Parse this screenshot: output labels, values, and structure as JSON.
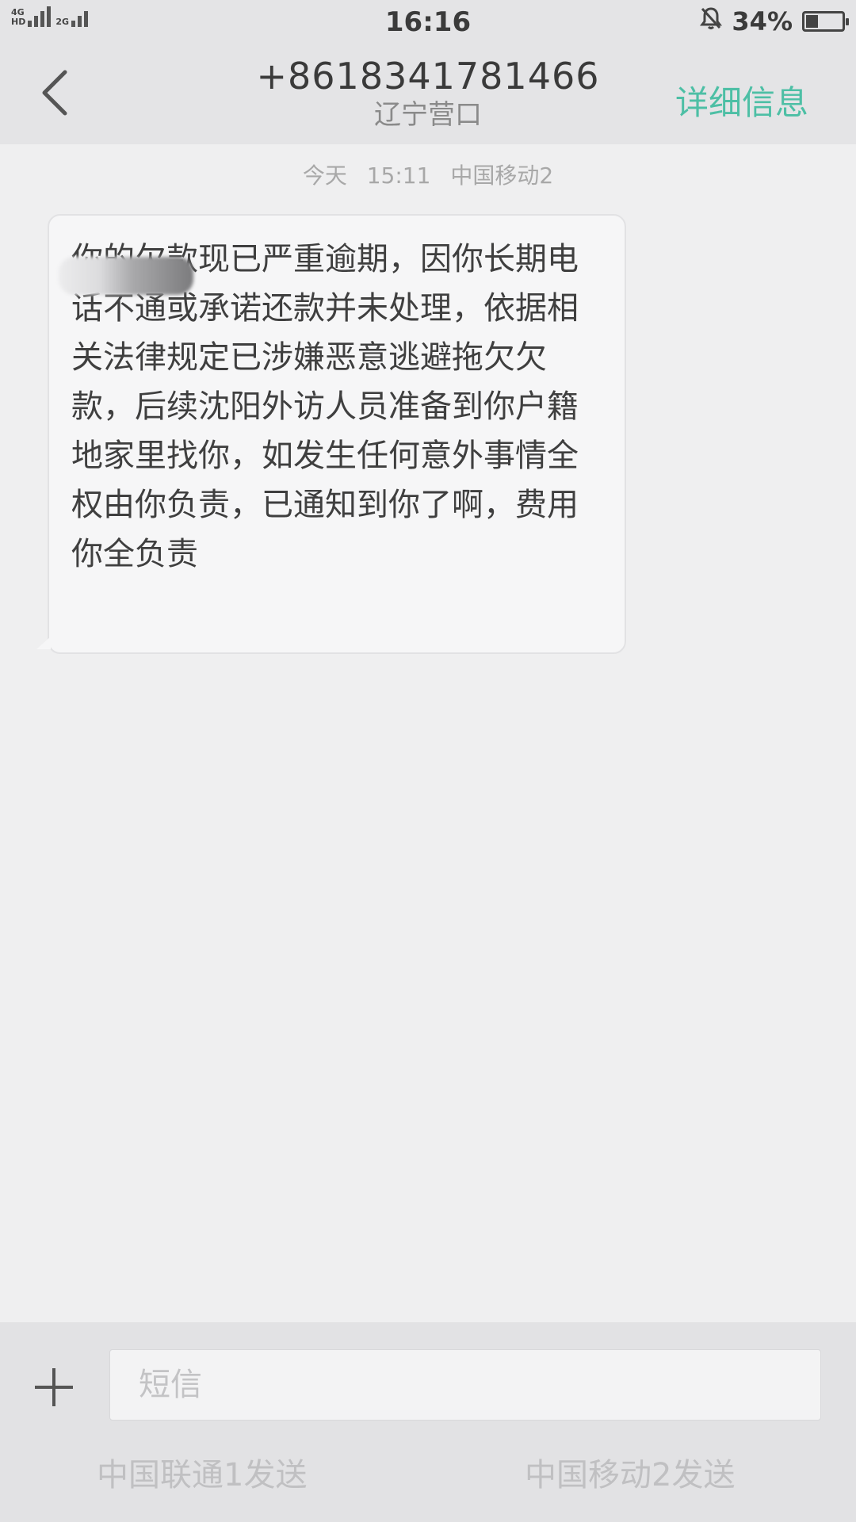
{
  "status_bar": {
    "network_1": "4G",
    "network_1_sub": "HD",
    "network_2": "2G",
    "time": "16:16",
    "battery_percent": "34%",
    "battery_level": 0.34
  },
  "header": {
    "phone_number": "+8618341781466",
    "location": "辽宁营口",
    "details_label": "详细信息",
    "details_color": "#4dbfa5"
  },
  "conversation": {
    "timestamp_day": "今天",
    "timestamp_time": "15:11",
    "timestamp_carrier": "中国移动2",
    "messages": [
      {
        "direction": "incoming",
        "text": "你的欠款现已严重逾期，因你长期电话不通或承诺还款并未处理，依据相关法律规定已涉嫌恶意逃避拖欠欠款，后续沈阳外访人员准备到你户籍地家里找你，如发生任何意外事情全权由你负责，已通知到你了啊，费用你全负责"
      }
    ]
  },
  "composer": {
    "placeholder": "短信",
    "send_sim1_label": "中国联通1发送",
    "send_sim2_label": "中国移动2发送"
  },
  "icons": {
    "back": "chevron-left-icon",
    "add": "plus-icon",
    "mute": "bell-off-icon",
    "battery": "battery-icon"
  }
}
